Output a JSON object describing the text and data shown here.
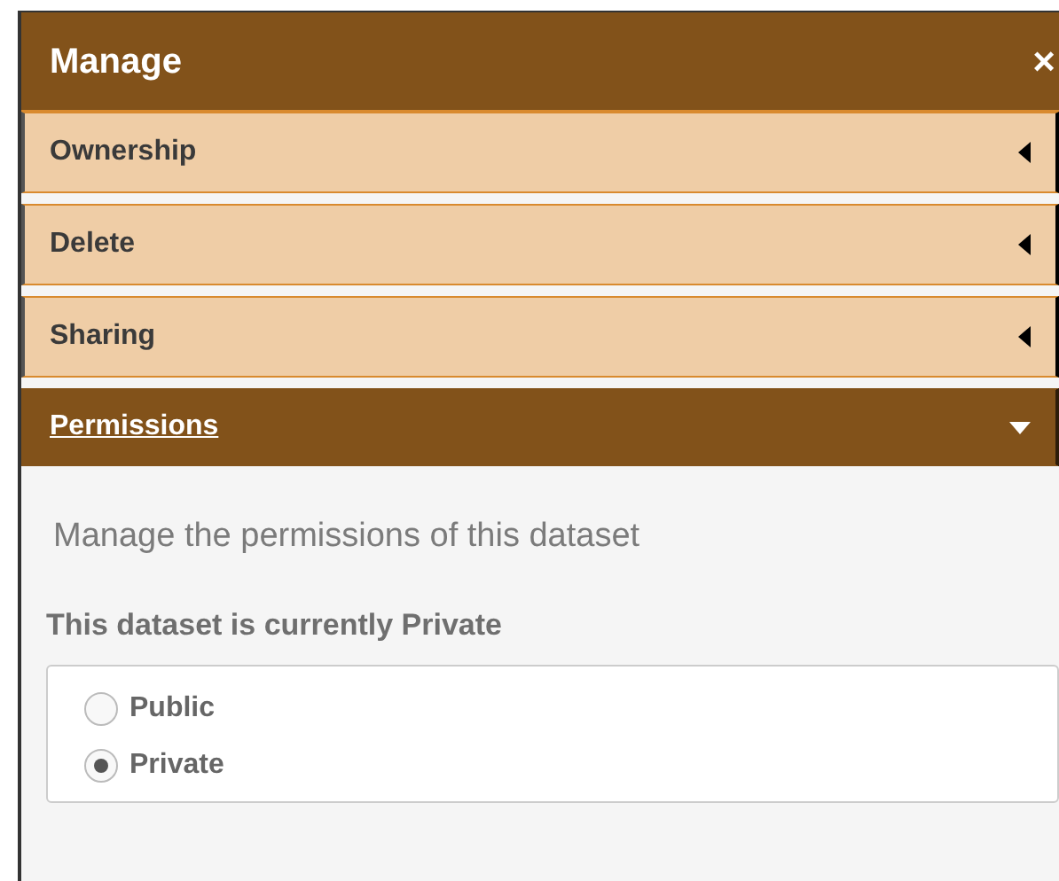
{
  "panel": {
    "title": "Manage",
    "close": "×"
  },
  "sections": [
    {
      "label": "Ownership",
      "expanded": false
    },
    {
      "label": "Delete",
      "expanded": false
    },
    {
      "label": "Sharing",
      "expanded": false
    },
    {
      "label": "Permissions",
      "expanded": true
    }
  ],
  "permissions": {
    "description": "Manage the permissions of this dataset",
    "status": "This dataset is currently Private",
    "options": [
      {
        "label": "Public",
        "selected": false
      },
      {
        "label": "Private",
        "selected": true
      }
    ]
  }
}
